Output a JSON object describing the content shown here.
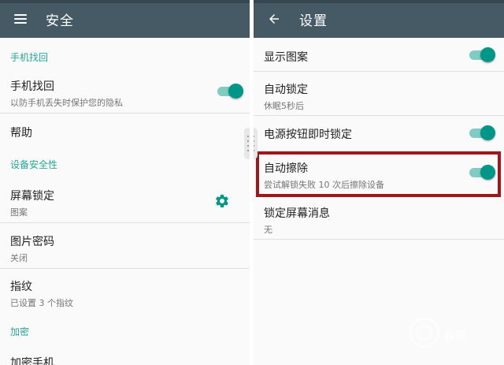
{
  "left": {
    "title": "安全",
    "nav_icon": "menu-icon",
    "sections": {
      "find_phone_header": "手机找回",
      "find_phone": {
        "title": "手机找回",
        "subtitle": "以防手机丢失时保护您的隐私",
        "enabled": true
      },
      "help": "帮助",
      "device_security_header": "设备安全性",
      "screen_lock": {
        "title": "屏幕锁定",
        "subtitle": "图案",
        "icon": "gear-icon"
      },
      "picture_password": {
        "title": "图片密码",
        "subtitle": "关闭"
      },
      "fingerprint": {
        "title": "指纹",
        "subtitle": "已设置 3 个指纹"
      },
      "encryption_header": "加密",
      "encrypt_phone": "加密手机"
    }
  },
  "right": {
    "title": "设置",
    "nav_icon": "back-arrow-icon",
    "items": {
      "show_pattern": {
        "title": "显示图案",
        "enabled": true
      },
      "auto_lock": {
        "title": "自动锁定",
        "subtitle": "休眠5秒后"
      },
      "power_button_lock": {
        "title": "电源按钮即时锁定",
        "enabled": true
      },
      "auto_wipe": {
        "title": "自动擦除",
        "subtitle": "尝试解锁失败 10 次后擦除设备",
        "enabled": true
      },
      "lock_screen_message": {
        "title": "锁定屏幕消息",
        "subtitle": "无"
      }
    }
  },
  "colors": {
    "toolbar": "#455a64",
    "accent": "#26a69a",
    "toggle_thumb": "#009688",
    "highlight_border": "#a2161a"
  },
  "watermark": {
    "logo_text": "极果"
  }
}
